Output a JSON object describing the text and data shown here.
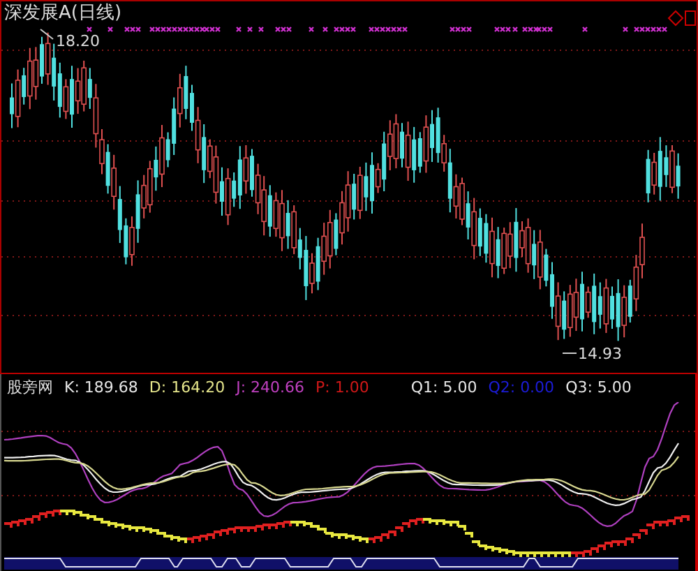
{
  "price_panel": {
    "title": "深发展A(日线)",
    "high_label": "18.20",
    "low_label": "14.93"
  },
  "indicator_panel": {
    "name": "股旁网",
    "values": [
      {
        "text": "K: 189.68",
        "color": "#e6e6e6"
      },
      {
        "text": "D: 164.20",
        "color": "#e6e68c"
      },
      {
        "text": "J: 240.66",
        "color": "#c040c0"
      },
      {
        "text": "P: 1.00",
        "color": "#d01818"
      },
      {
        "text": "Q1: 5.00",
        "color": "#e6e6e6"
      },
      {
        "text": "Q2: 0.00",
        "color": "#1c1cd8"
      },
      {
        "text": "Q3: 5.00",
        "color": "#e6e6e6"
      }
    ]
  }
}
